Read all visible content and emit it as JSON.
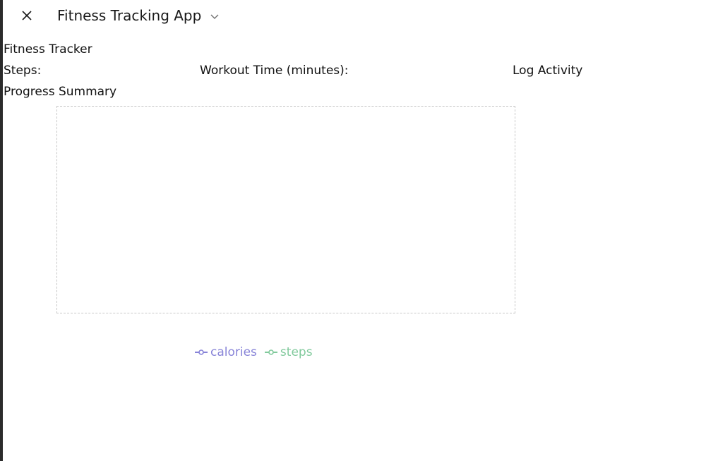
{
  "window": {
    "title": "Fitness Tracking App"
  },
  "form": {
    "heading": "Fitness Tracker",
    "steps_label": "Steps:",
    "steps_value": "",
    "workout_label": "Workout Time (minutes):",
    "workout_value": "",
    "log_button": "Log Activity"
  },
  "summary": {
    "label": "Progress Summary"
  },
  "chart_data": {
    "type": "line",
    "title": "",
    "xlabel": "",
    "ylabel": "",
    "categories": [],
    "series": [
      {
        "name": "calories",
        "values": [],
        "color": "#8884d8"
      },
      {
        "name": "steps",
        "values": [],
        "color": "#82ca9d"
      }
    ],
    "grid": false,
    "legend_position": "bottom"
  },
  "icons": {
    "close": "close-icon",
    "dropdown": "chevron-down-icon"
  }
}
